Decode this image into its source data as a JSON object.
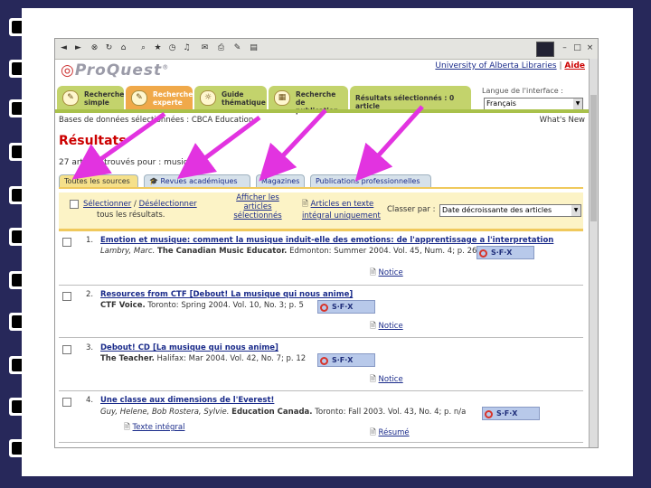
{
  "browser": {
    "toolbar_icons": [
      "back-icon",
      "forward-icon",
      "stop-icon",
      "refresh-icon",
      "home-icon",
      "search-icon",
      "favorites-icon",
      "history-icon",
      "media-icon",
      "mail-icon",
      "print-icon",
      "edit-icon",
      "discuss-icon"
    ]
  },
  "header": {
    "logo": "ProQuest",
    "logo_mark": "®",
    "institution_link": "University of Alberta Libraries",
    "separator": "|",
    "help_link": "Aide"
  },
  "tabs": [
    {
      "l1": "Recherche",
      "l2": "simple",
      "icon": "✎"
    },
    {
      "l1": "Recherche",
      "l2": "experte",
      "icon": "✎"
    },
    {
      "l1": "Guide",
      "l2": "thématique",
      "icon": "☼"
    },
    {
      "l1": "Recherche",
      "l2": "de publication",
      "icon": "▦"
    },
    {
      "l1": "Résultats sélectionnés : 0 article",
      "l2": "",
      "icon": ""
    }
  ],
  "language": {
    "label": "Langue de l'interface :",
    "value": "Français"
  },
  "db_line": "Bases de données sélectionnées : CBCA Education",
  "whats_new": "What's New",
  "results_title": "Résultats",
  "count": "27 articles trouvés pour : musique",
  "source_tabs": [
    "Toutes les sources",
    "Revues académiques",
    "Magazines",
    "Publications professionnelles"
  ],
  "options": {
    "select_all": "Sélectionner",
    "slash": " / ",
    "deselect_all": "Désélectionner",
    "all_results": "tous les résultats.",
    "show_l1": "Afficher les",
    "show_l2": "articles",
    "show_l3": "sélectionnés",
    "fulltext_l1": "Articles en texte",
    "fulltext_l2": "intégral uniquement",
    "sort_label": "Classer par :",
    "sort_value": "Date décroissante des articles"
  },
  "records": [
    {
      "num": "1.",
      "title": "Emotion et musique: comment la musique induit-elle des emotions: de l'apprentissage a l'interpretation",
      "author": "Lambry, Marc.",
      "pub": "The Canadian Music Educator.",
      "details": "Edmonton: Summer 2004. Vol. 45, Num. 4; p. 26",
      "link": "Notice"
    },
    {
      "num": "2.",
      "title": "Resources from CTF [Debout! La musique qui nous anime]",
      "author": "",
      "pub": "CTF Voice.",
      "details": "Toronto: Spring 2004. Vol. 10, No. 3; p. 5",
      "link": "Notice"
    },
    {
      "num": "3.",
      "title": "Debout! CD [La musique qui nous anime]",
      "author": "",
      "pub": "The Teacher.",
      "details": "Halifax: Mar 2004. Vol. 42, No. 7; p. 12",
      "link": "Notice"
    },
    {
      "num": "4.",
      "title": "Une classe aux dimensions de l'Everest!",
      "author": "Guy, Helene, Bob Rostera, Sylvie.",
      "pub": "Education Canada.",
      "details": "Toronto: Fall 2003. Vol. 43, No. 4; p. n/a",
      "link": "Résumé",
      "fulltext": "Texte intégral"
    }
  ],
  "sfx_label": "S·F·X",
  "colors": {
    "arrow": "#e233e0",
    "tab_green": "#c3d36c",
    "tab_orange": "#f0a94a",
    "link": "#1a2b8a"
  }
}
